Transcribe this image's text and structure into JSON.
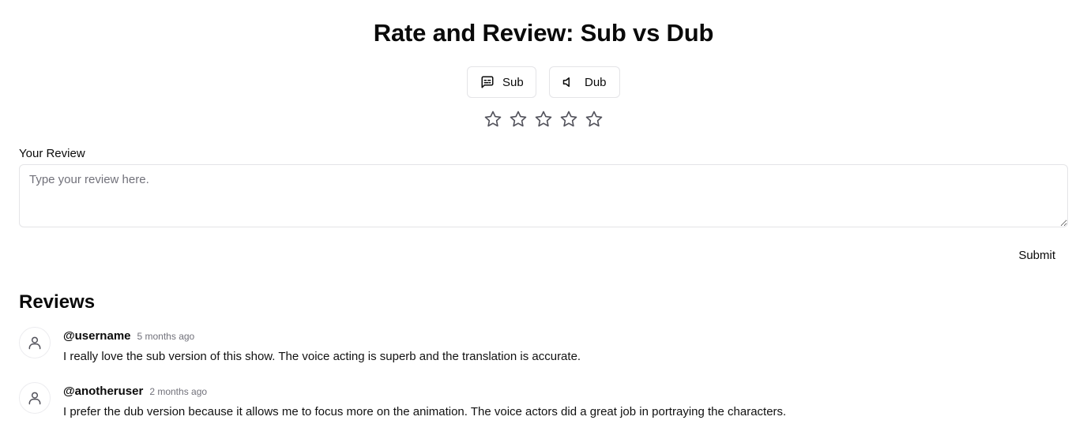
{
  "page": {
    "title": "Rate and Review: Sub vs Dub"
  },
  "toggles": {
    "sub_label": "Sub",
    "dub_label": "Dub"
  },
  "rating": {
    "max_stars": 5,
    "selected": 0
  },
  "review_form": {
    "label": "Your Review",
    "placeholder": "Type your review here.",
    "value": "",
    "submit_label": "Submit"
  },
  "reviews": {
    "heading": "Reviews",
    "items": [
      {
        "username": "@username",
        "time": "5 months ago",
        "text": "I really love the sub version of this show. The voice acting is superb and the translation is accurate."
      },
      {
        "username": "@anotheruser",
        "time": "2 months ago",
        "text": "I prefer the dub version because it allows me to focus more on the animation. The voice actors did a great job in portraying the characters."
      }
    ]
  },
  "colors": {
    "border": "#e4e4e7",
    "muted_text": "#71717a",
    "star_stroke": "#52525b"
  }
}
